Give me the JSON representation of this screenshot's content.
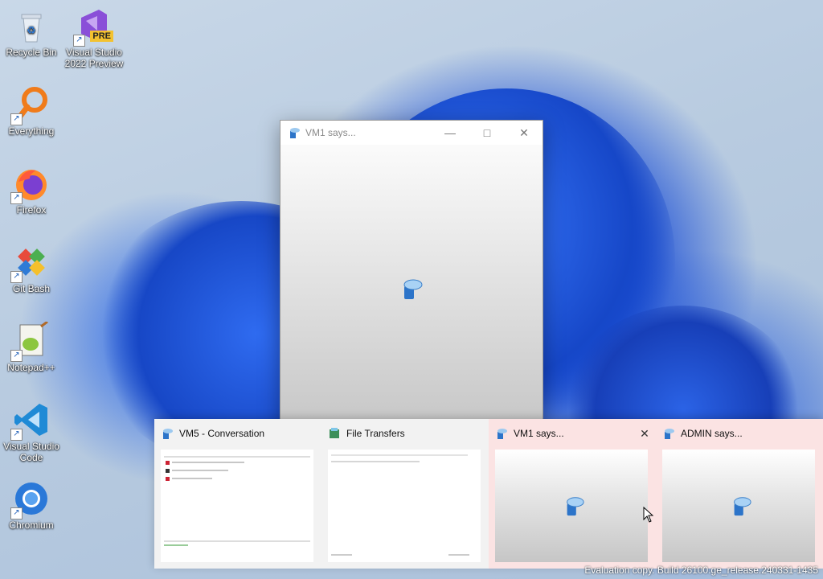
{
  "desktop": {
    "icons": [
      {
        "label": "Recycle Bin",
        "icon": "recycle-bin-icon"
      },
      {
        "label": "Visual Studio 2022 Preview",
        "icon": "visual-studio-preview-icon",
        "badge": "PRE"
      },
      {
        "label": "Everything",
        "icon": "everything-search-icon"
      },
      {
        "label": "Firefox",
        "icon": "firefox-icon"
      },
      {
        "label": "Git Bash",
        "icon": "git-bash-icon"
      },
      {
        "label": "Notepad++",
        "icon": "notepad-plus-plus-icon"
      },
      {
        "label": "Visual Studio Code",
        "icon": "vscode-icon"
      },
      {
        "label": "Chromium",
        "icon": "chromium-icon"
      }
    ]
  },
  "window": {
    "title": "VM1 says...",
    "minimize": "—",
    "maximize": "□",
    "close": "✕"
  },
  "taskbar_previews": [
    {
      "title": "VM5 - Conversation"
    },
    {
      "title": "File Transfers"
    },
    {
      "title": "VM1 says...",
      "close": "✕"
    },
    {
      "title": "ADMIN says..."
    }
  ],
  "watermark": "Evaluation copy. Build 26100.ge_release.240331-1435",
  "colors": {
    "wallpaper_blue": "#1b4fd6",
    "hover_tint": "#fbe3e3"
  }
}
